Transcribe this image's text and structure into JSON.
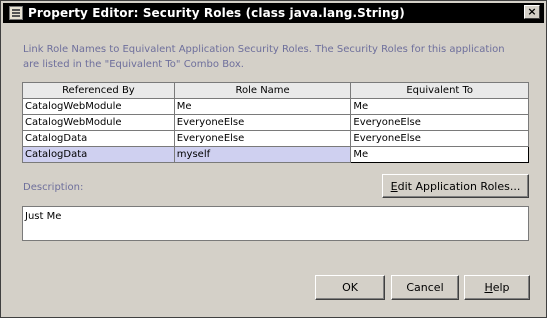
{
  "window": {
    "title": "Property Editor: Security Roles (class java.lang.String)",
    "close_glyph": "×"
  },
  "intro": {
    "line1": "Link Role Names to Equivalent Application Security Roles.  The Security Roles for this application",
    "line2": "are listed in the \"Equivalent To\" Combo Box."
  },
  "table": {
    "headers": [
      "Referenced By",
      "Role Name",
      "Equivalent To"
    ],
    "rows": [
      [
        "CatalogWebModule",
        "Me",
        "Me"
      ],
      [
        "CatalogWebModule",
        "EveryoneElse",
        "EveryoneElse"
      ],
      [
        "CatalogData",
        "EveryoneElse",
        "EveryoneElse"
      ],
      [
        "CatalogData",
        "myself",
        "Me"
      ]
    ],
    "selected_row": 3
  },
  "description": {
    "label": "Description:",
    "value": "Just Me"
  },
  "buttons": {
    "edit_roles_prefix": "",
    "edit_roles_mnemonic": "E",
    "edit_roles_rest": "dit Application Roles...",
    "ok": "OK",
    "cancel": "Cancel",
    "help_mnemonic": "H",
    "help_rest": "elp"
  }
}
